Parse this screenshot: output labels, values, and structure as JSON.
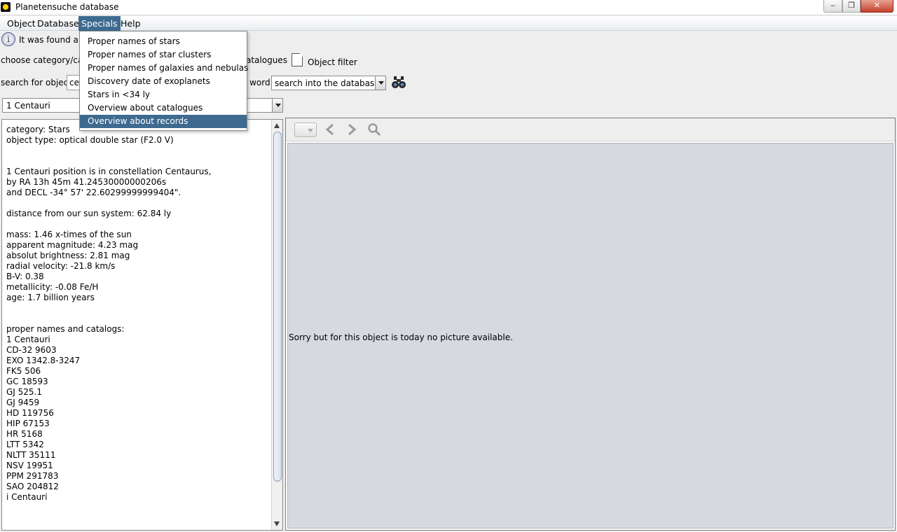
{
  "window": {
    "title": "Planetensuche database",
    "minimize": "‒",
    "maximize": "❐",
    "close": "✕"
  },
  "menu": [
    "Object",
    "Database",
    "Specials",
    "Help"
  ],
  "specials_menu": {
    "items": [
      "Proper names of stars",
      "Proper names of star clusters",
      "Proper names of galaxies and nebulas",
      "Discovery date of exoplanets",
      "Stars in <34 ly",
      "Overview about catalogues",
      "Overview about records"
    ],
    "selected": "Overview about records"
  },
  "info": {
    "icon": "info-icon",
    "text": "It was found a to"
  },
  "filters": {
    "category_label": "choose category/cata",
    "catalogues_label": "atalogues",
    "object_filter_label": "Object filter"
  },
  "search": {
    "label": "search for object:",
    "value": "ce",
    "word_label": "s word",
    "mode_value": "search into the database"
  },
  "object_select": {
    "value": "1 Centauri"
  },
  "details": {
    "lines": [
      "category: Stars",
      "object type: optical double star (F2.0 V)",
      "",
      "",
      "1 Centauri position is in constellation Centaurus,",
      "by RA 13h 45m 41.24530000000206s",
      "and DECL -34° 57' 22.60299999999404\".",
      "",
      "distance from our sun system: 62.84 ly",
      "",
      "mass: 1.46 x-times of the sun",
      "apparent magnitude: 4.23 mag",
      "absolut brightness: 2.81 mag",
      "radial velocity: -21.8 km/s",
      "B-V: 0.38",
      "metallicity: -0.08 Fe/H",
      "age: 1.7 billion years",
      "",
      "",
      "proper names and catalogs:",
      "1 Centauri",
      "CD-32 9603",
      "EXO 1342.8-3247",
      "FK5 506",
      "GC 18593",
      "GJ 525.1",
      "GJ 9459",
      "HD 119756",
      "HIP 67153",
      "HR 5168",
      "LTT 5342",
      "NLTT 35111",
      "NSV 19951",
      "PPM 291783",
      "SAO 204812",
      "i Centauri"
    ]
  },
  "viewer": {
    "no_picture_text": "Sorry but for this object is today no picture available."
  },
  "colors": {
    "menu_highlight": "#3e6a90",
    "canvas": "#d6d9e0"
  }
}
